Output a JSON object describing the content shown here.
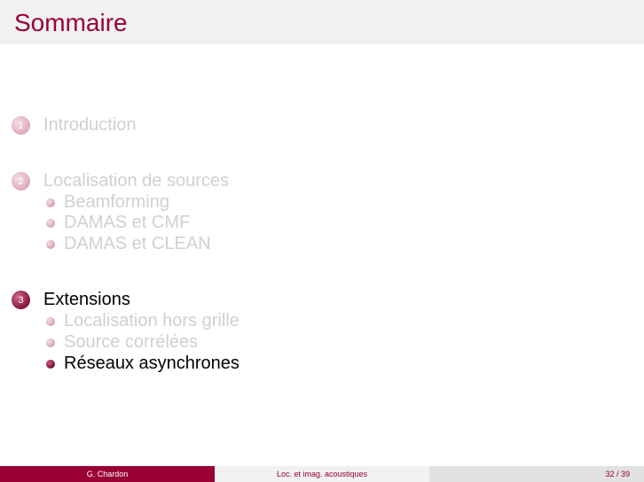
{
  "frame": {
    "title": "Sommaire"
  },
  "toc": {
    "sections": [
      {
        "number": "1",
        "label": "Introduction"
      },
      {
        "number": "2",
        "label": "Localisation de sources",
        "subsections": [
          "Beamforming",
          "DAMAS et CMF",
          "DAMAS et CLEAN"
        ]
      },
      {
        "number": "3",
        "label": "Extensions",
        "subsections": [
          "Localisation hors grille",
          "Source corrélées",
          "Réseaux asynchrones"
        ]
      }
    ]
  },
  "footer": {
    "author": "G. Chardon",
    "title": "Loc. et imag. acoustiques",
    "page": "32 / 39"
  },
  "colors": {
    "accent": "#990033",
    "faded_text": "#d0d0d0"
  }
}
